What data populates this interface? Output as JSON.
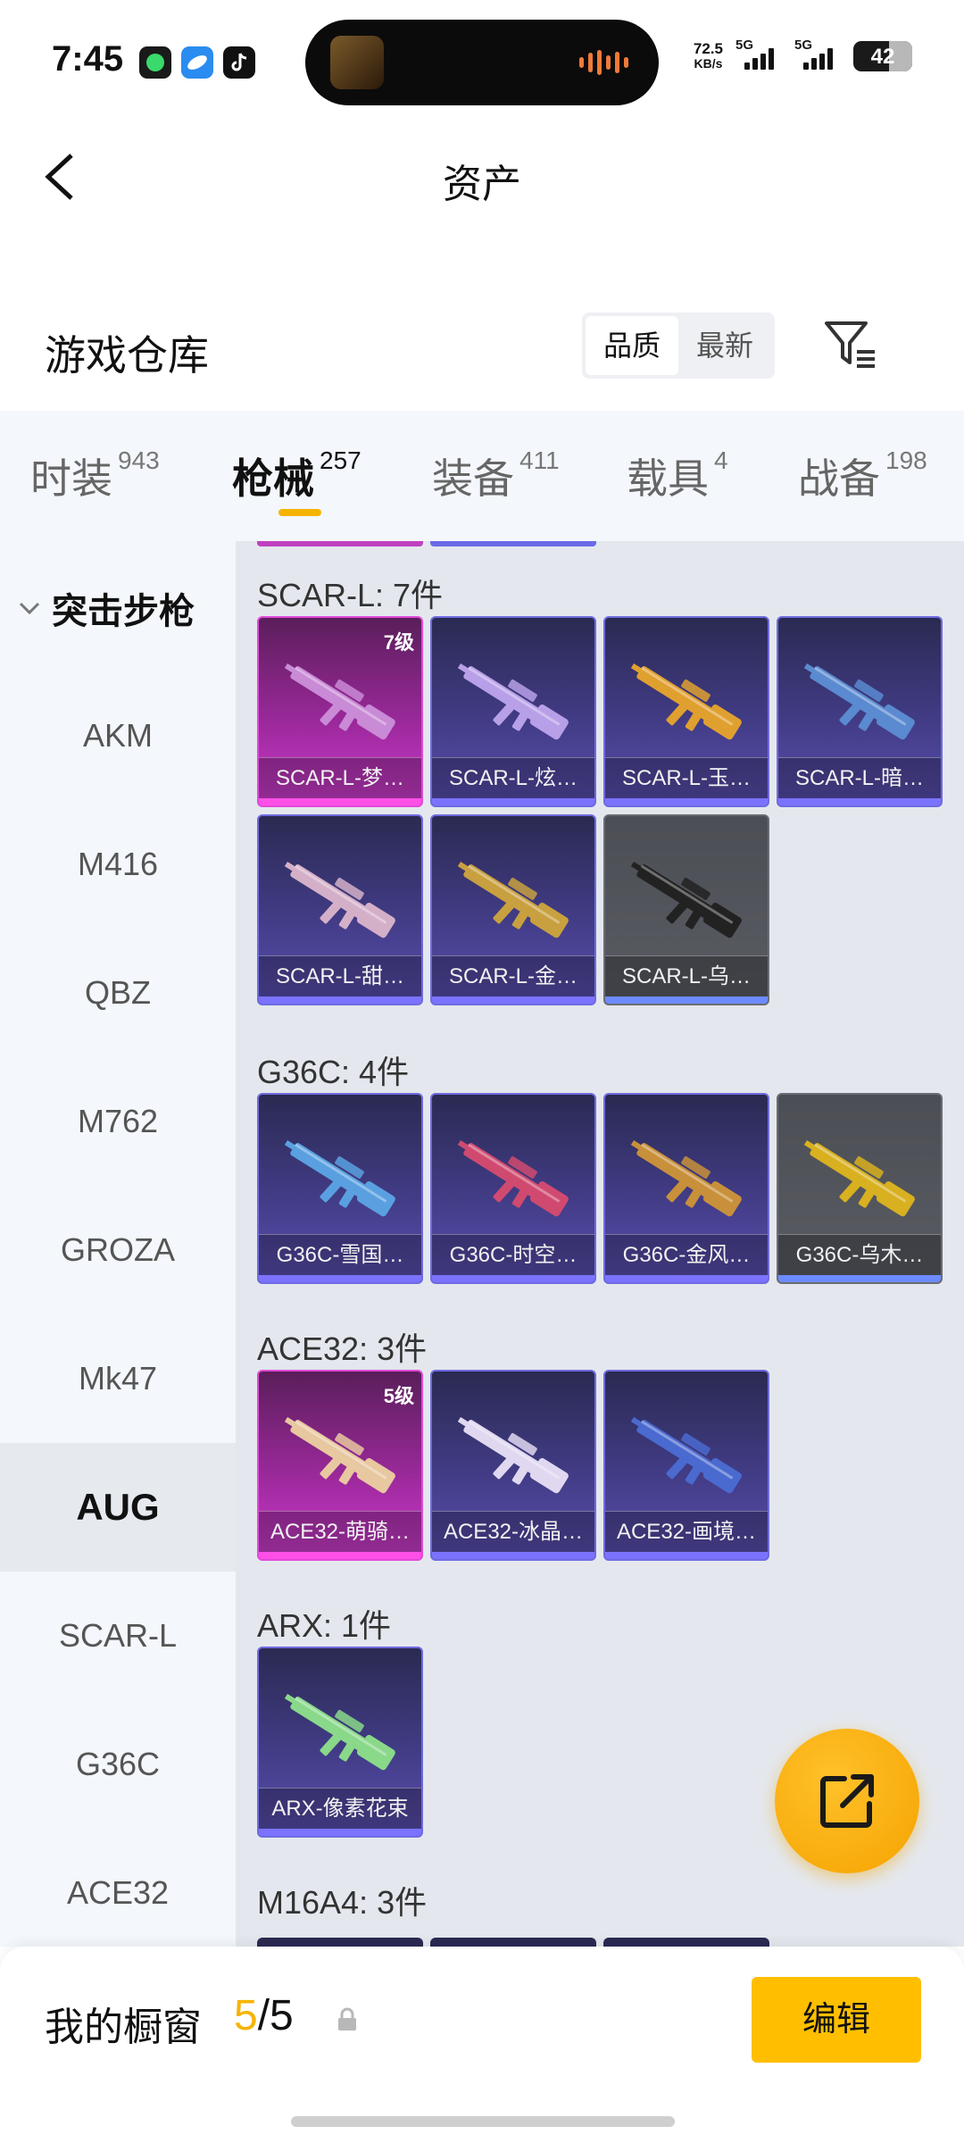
{
  "status_bar": {
    "time": "7:45",
    "net_speed_value": "72.5",
    "net_speed_unit": "KB/s",
    "signal_1_label": "5G",
    "signal_2_label": "5G",
    "battery": "42"
  },
  "header": {
    "title": "资产"
  },
  "warehouse": {
    "title": "游戏仓库",
    "sort_options": [
      "品质",
      "最新"
    ],
    "active_sort": "品质"
  },
  "tabs": [
    {
      "label": "时装",
      "count": "943"
    },
    {
      "label": "枪械",
      "count": "257"
    },
    {
      "label": "装备",
      "count": "411"
    },
    {
      "label": "载具",
      "count": "4"
    },
    {
      "label": "战备",
      "count": "198"
    }
  ],
  "active_tab": "枪械",
  "sidebar": {
    "group": "突击步枪",
    "items": [
      "AKM",
      "M416",
      "QBZ",
      "M762",
      "GROZA",
      "Mk47",
      "AUG",
      "SCAR-L",
      "G36C",
      "ACE32"
    ],
    "active_item": "AUG"
  },
  "groups": [
    {
      "title": "SCAR-L: 7件",
      "items": [
        {
          "label": "SCAR-L-梦…",
          "rarity": "pink",
          "level": "7级",
          "gun_color": "#c98ad6"
        },
        {
          "label": "SCAR-L-炫…",
          "rarity": "purple",
          "level": "",
          "gun_color": "#b8a0e8"
        },
        {
          "label": "SCAR-L-玉…",
          "rarity": "purple",
          "level": "",
          "gun_color": "#e0a030"
        },
        {
          "label": "SCAR-L-暗…",
          "rarity": "purple",
          "level": "",
          "gun_color": "#5a8ad0"
        },
        {
          "label": "SCAR-L-甜…",
          "rarity": "purple",
          "level": "",
          "gun_color": "#d4b0c8"
        },
        {
          "label": "SCAR-L-金…",
          "rarity": "purple",
          "level": "",
          "gun_color": "#c8a040"
        },
        {
          "label": "SCAR-L-乌…",
          "rarity": "gray",
          "level": "",
          "gun_color": "#222222"
        }
      ]
    },
    {
      "title": "G36C: 4件",
      "items": [
        {
          "label": "G36C-雪国…",
          "rarity": "purple",
          "level": "",
          "gun_color": "#5aa0e0"
        },
        {
          "label": "G36C-时空…",
          "rarity": "purple",
          "level": "",
          "gun_color": "#d04a70"
        },
        {
          "label": "G36C-金风…",
          "rarity": "purple",
          "level": "",
          "gun_color": "#c8903a"
        },
        {
          "label": "G36C-乌木…",
          "rarity": "gray",
          "level": "",
          "gun_color": "#d8b020"
        }
      ]
    },
    {
      "title": "ACE32: 3件",
      "items": [
        {
          "label": "ACE32-萌骑…",
          "rarity": "pink",
          "level": "5级",
          "gun_color": "#e8c8a0"
        },
        {
          "label": "ACE32-冰晶…",
          "rarity": "purple",
          "level": "",
          "gun_color": "#e0d8f0"
        },
        {
          "label": "ACE32-画境…",
          "rarity": "purple",
          "level": "",
          "gun_color": "#4a6ad0"
        }
      ]
    },
    {
      "title": "ARX: 1件",
      "items": [
        {
          "label": "ARX-像素花束",
          "rarity": "purple",
          "level": "",
          "gun_color": "#8ad88a"
        }
      ]
    },
    {
      "title": "M16A4: 3件",
      "items": []
    }
  ],
  "bottom_bar": {
    "label": "我的橱窗",
    "current": "5",
    "separator": "/",
    "total": "5",
    "edit_label": "编辑"
  },
  "colors": {
    "accent": "#ffbf00",
    "tab_underline": "#f5b400",
    "rarity_purple": "#6f6be0",
    "rarity_pink": "#e04ad8"
  }
}
